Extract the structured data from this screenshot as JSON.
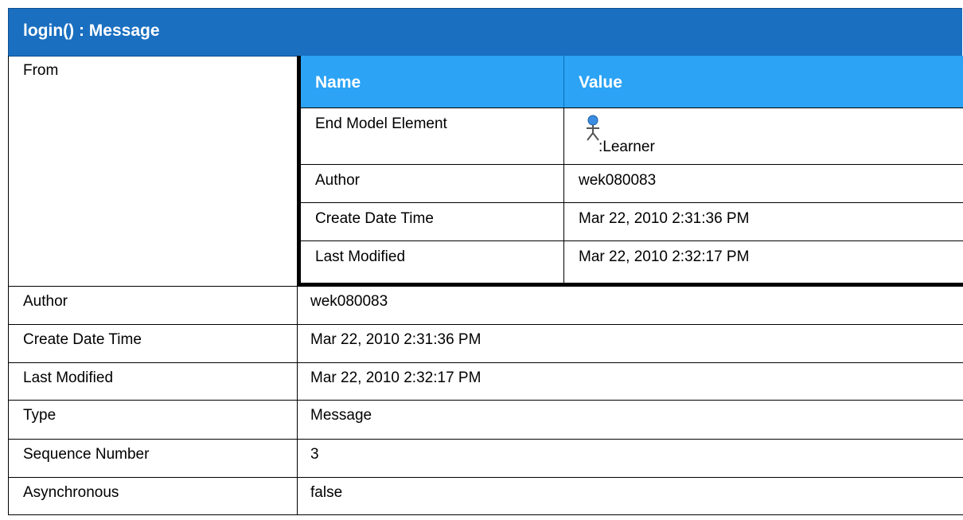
{
  "title": "login() : Message",
  "from_label": "From",
  "nested": {
    "header": {
      "name": "Name",
      "value": "Value"
    },
    "rows": [
      {
        "name": "End Model Element",
        "value": ":Learner",
        "icon": "actor-icon"
      },
      {
        "name": "Author",
        "value": "wek080083"
      },
      {
        "name": "Create Date Time",
        "value": "Mar 22, 2010 2:31:36 PM"
      },
      {
        "name": "Last Modified",
        "value": "Mar 22, 2010 2:32:17 PM"
      }
    ]
  },
  "properties": [
    {
      "label": "Author",
      "value": "wek080083"
    },
    {
      "label": "Create Date Time",
      "value": "Mar 22, 2010 2:31:36 PM"
    },
    {
      "label": "Last Modified",
      "value": "Mar 22, 2010 2:32:17 PM"
    },
    {
      "label": "Type",
      "value": "Message"
    },
    {
      "label": "Sequence Number",
      "value": "3"
    },
    {
      "label": "Asynchronous",
      "value": "false"
    }
  ],
  "colors": {
    "title_bg": "#1a6fc0",
    "nested_header_bg": "#2ca3f5",
    "actor_head": "#3a8de0"
  }
}
